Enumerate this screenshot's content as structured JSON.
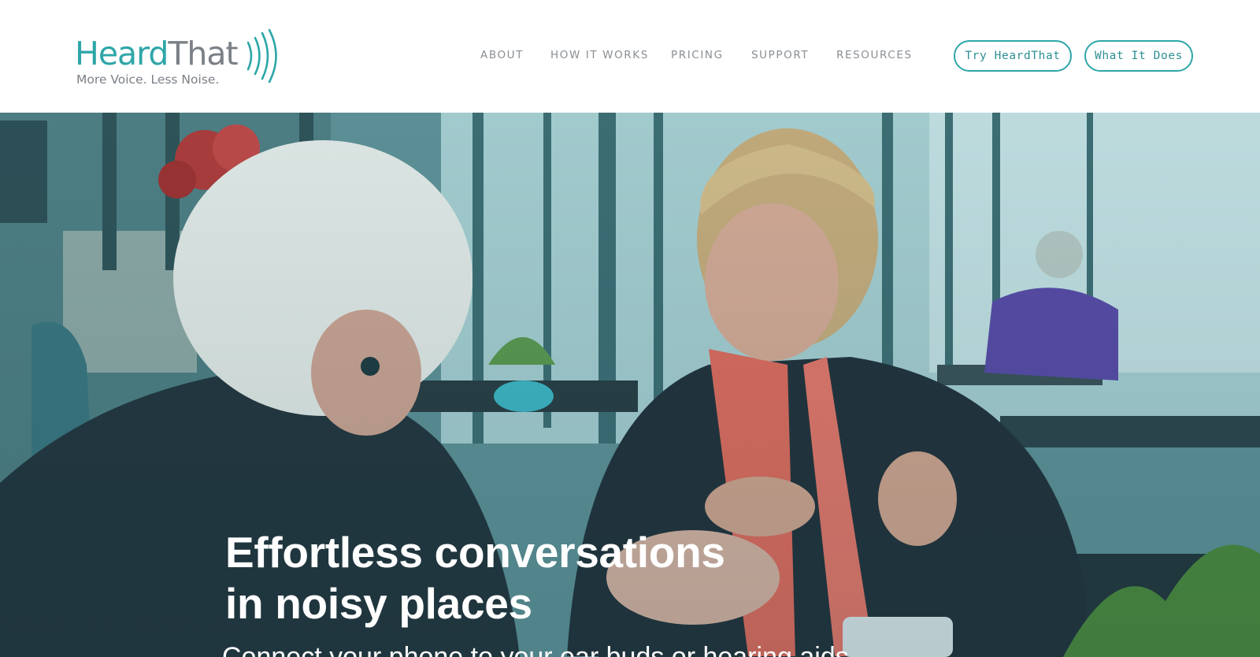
{
  "brand": {
    "name_part1": "Heard",
    "name_part2": "That",
    "tagline": "More Voice. Less Noise.",
    "accent_color": "#2ea6a8",
    "text_color": "#7a8086"
  },
  "nav": {
    "items": [
      {
        "label": "ABOUT"
      },
      {
        "label": "HOW IT WORKS"
      },
      {
        "label": "PRICING"
      },
      {
        "label": "SUPPORT"
      },
      {
        "label": "RESOURCES"
      }
    ]
  },
  "cta": {
    "try_label": "Try HeardThat",
    "what_label": "What It Does"
  },
  "hero": {
    "title_line1": "Effortless conversations",
    "title_line2": "in noisy places",
    "subtitle": "Connect your phone to your ear buds or hearing aids"
  }
}
